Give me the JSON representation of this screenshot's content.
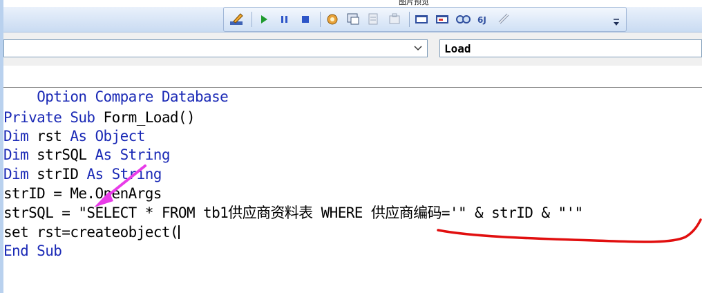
{
  "window": {
    "title": "图片预览"
  },
  "toolbar": {
    "buttons": [
      {
        "name": "design-mode-icon"
      },
      {
        "name": "run-icon"
      },
      {
        "name": "break-icon"
      },
      {
        "name": "reset-icon"
      },
      {
        "name": "object-browser-icon"
      },
      {
        "name": "project-explorer-icon"
      },
      {
        "name": "properties-icon"
      },
      {
        "name": "toolbox-icon"
      },
      {
        "name": "immediate-icon"
      },
      {
        "name": "locals-icon"
      },
      {
        "name": "watch-icon"
      },
      {
        "name": "call-stack-icon"
      },
      {
        "name": "find-icon"
      }
    ]
  },
  "combo": {
    "object_value": "",
    "procedure_value": "Load"
  },
  "code": {
    "line1_kw": "Option Compare Database",
    "line2_kw1": "Private Sub ",
    "line2_rest": "Form_Load()",
    "line3_kw": "Dim",
    "line3_mid": " rst ",
    "line3_kw2": "As Object",
    "line4_kw": "Dim",
    "line4_mid": " strSQL ",
    "line4_kw2": "As String",
    "line5_kw": "Dim",
    "line5_mid": " strID ",
    "line5_kw2": "As String",
    "line6": "strID = Me.OpenArgs",
    "line7": "strSQL = \"SELECT * FROM tb1供应商资料表 WHERE 供应商编码='\" & strID & \"'\"",
    "line8": "set rst=createobject(",
    "line9_kw": "End Sub"
  },
  "annotations": {
    "arrow_color": "#e83ce8",
    "underline_color": "#e10f0f"
  }
}
